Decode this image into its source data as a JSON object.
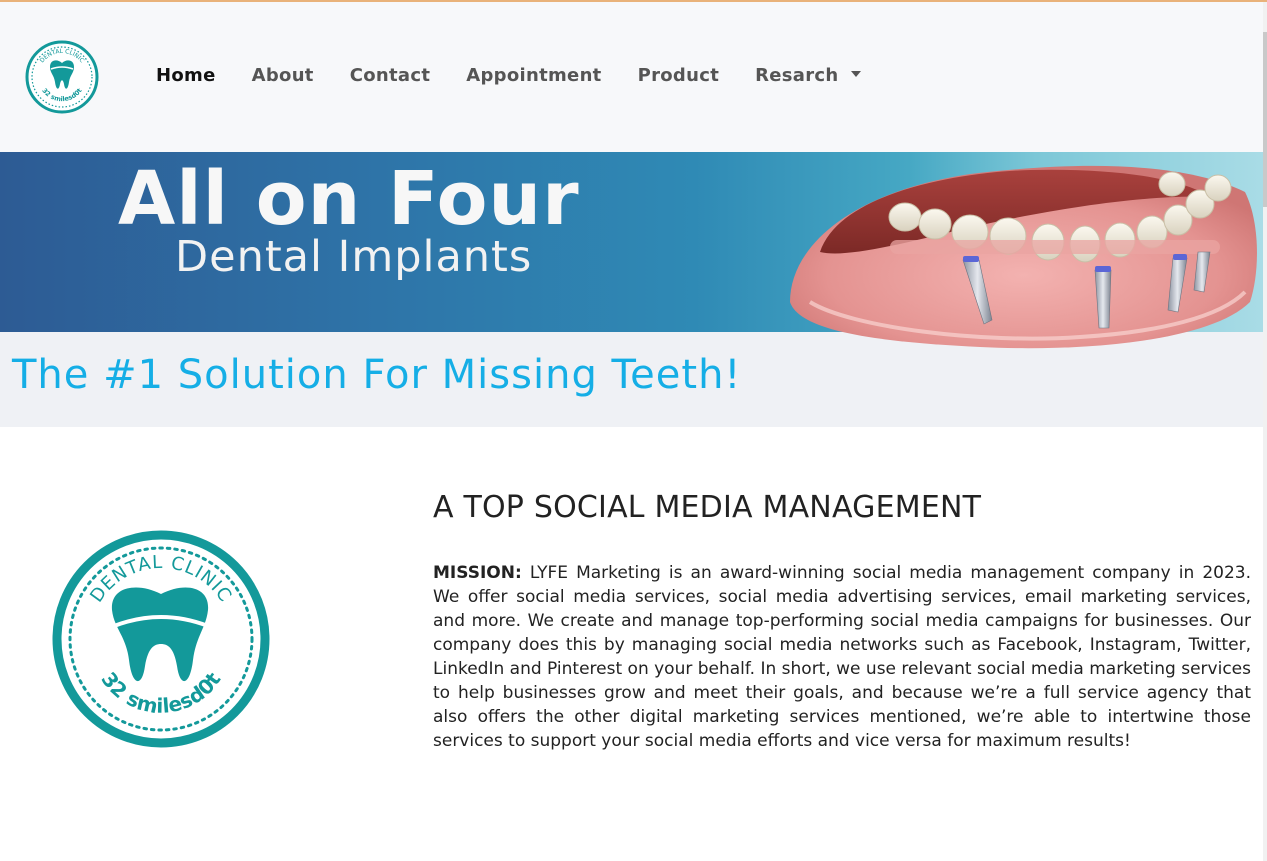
{
  "nav": {
    "brand_text_top": "DENTAL CLINIC",
    "brand_text_bottom": "32 smilesd0t",
    "items": [
      {
        "label": "Home",
        "active": true
      },
      {
        "label": "About"
      },
      {
        "label": "Contact"
      },
      {
        "label": "Appointment"
      },
      {
        "label": "Product"
      },
      {
        "label": "Resarch",
        "dropdown": true
      }
    ]
  },
  "hero": {
    "title": "All on Four",
    "subtitle": "Dental Implants",
    "tagline": "The #1 Solution For Missing Teeth!"
  },
  "logo": {
    "text_top": "DENTAL CLINIC",
    "text_bottom": "32 smilesd0t"
  },
  "content": {
    "heading": "A TOP SOCIAL MEDIA MANAGEMENT",
    "mission_label": "MISSION:",
    "mission_text": " LYFE Marketing is an award-winning social media management company in 2023. We offer social media services, social media advertising services, email marketing services, and more. We create and manage top-performing social media campaigns for businesses. Our company does this by managing social media networks such as Facebook, Instagram, Twitter, LinkedIn and Pinterest on your behalf. In short, we use relevant social media marketing services to help businesses grow and meet their goals, and because we’re a full service agency that also offers the other digital marketing services mentioned, we’re able to intertwine those services to support your social media efforts and vice versa for maximum results!"
  },
  "colors": {
    "brand_teal": "#13999a",
    "tagline_blue": "#15aee6",
    "nav_text": "#555555"
  }
}
